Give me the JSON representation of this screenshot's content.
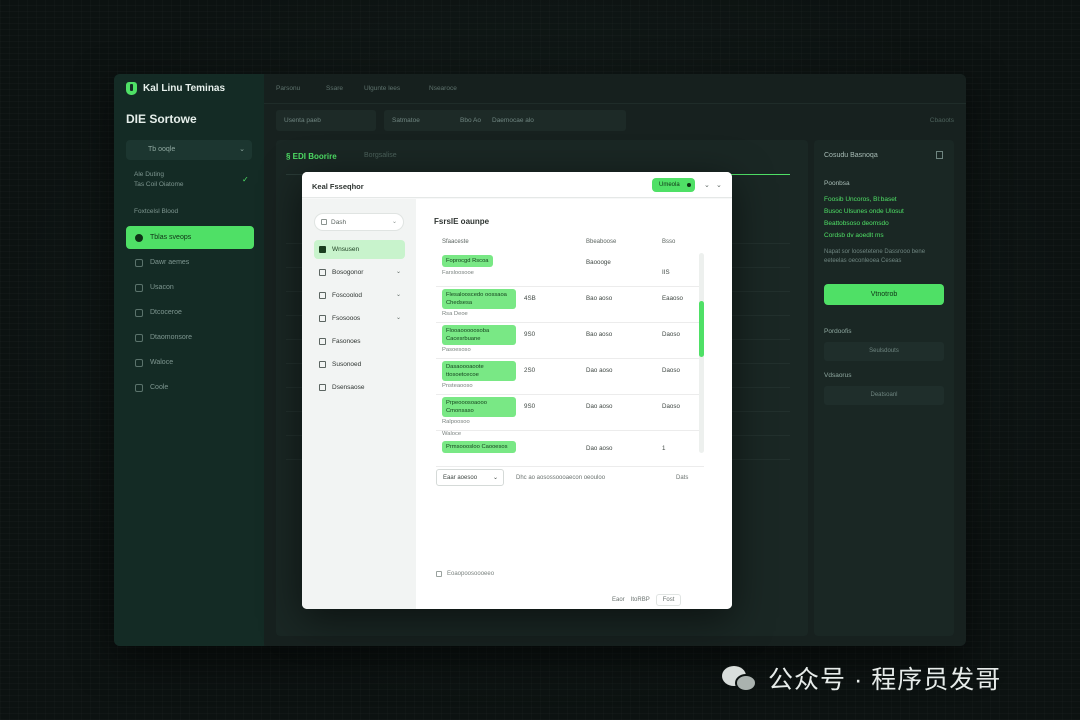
{
  "app": {
    "brand": "Kal Linu Teminas",
    "section_title": "DIE Sortowe",
    "sidebar_select": "Tb ooqle",
    "sidebar_info": [
      "Ale Duting",
      "Tas Coil Oiatome"
    ],
    "sidebar_group": "Foxtcelsl Blood",
    "nav": [
      {
        "label": "Tblas sveops",
        "active": true
      },
      {
        "label": "Dawr aemes",
        "active": false
      },
      {
        "label": "Usacon",
        "active": false
      },
      {
        "label": "Dtcoceroe",
        "active": false
      },
      {
        "label": "Dtaomonsore",
        "active": false
      },
      {
        "label": "Waloce",
        "active": false
      },
      {
        "label": "Coole",
        "active": false
      }
    ],
    "topnav": [
      "Parsonu",
      "Ssare",
      "Ulgunte lees",
      "Nsearoce"
    ],
    "filters": [
      "Usenta paeb",
      "Satmatoe",
      "Bbo Ao",
      "Daemocae alo"
    ],
    "filter_right": "Cbaoots",
    "main_title": "§ EDI Boorire",
    "main_sub": "Borgsalise",
    "right_panel": {
      "header": "Cosudu Basnoqa",
      "label": "Poonbsa",
      "green_lines": [
        "Foosib Uncoros, Bl:baset",
        "Busoc Ulsunes onde Ulosut",
        "Beattobsoso deomsdo",
        "Cordsb dv aoedlt ms"
      ],
      "muted": "Napat sor loosetetene Dassrooo bene eeteelas oeconleoea Ceseas",
      "button": "Vtnotrob",
      "sub1": "Pordoofis",
      "box1": "Seulsdouts",
      "sub2": "Vdsaorus",
      "box2": "Deatsoanl"
    }
  },
  "modal": {
    "title": "Keal Fsseqhor",
    "badge": "Umeola",
    "search": "Dash",
    "nav": [
      {
        "label": "Wnsusen",
        "active": true,
        "chevron": false
      },
      {
        "label": "Bosogonor",
        "active": false,
        "chevron": true
      },
      {
        "label": "Foscoolod",
        "active": false,
        "chevron": true
      },
      {
        "label": "Fsosooos",
        "active": false,
        "chevron": true
      },
      {
        "label": "Fasonoes",
        "active": false,
        "chevron": false
      },
      {
        "label": "Susonoed",
        "active": false,
        "chevron": false
      },
      {
        "label": "Dsensaose",
        "active": false,
        "chevron": false
      }
    ],
    "section_title": "FsrslE oaunpe",
    "columns": [
      "Sfaaceste",
      "Bbeaboose",
      "Bsso"
    ],
    "rows": [
      {
        "pill": "Foprocgd Rscoa",
        "sub": "Farsloosooe",
        "num": "",
        "c2": "Baoooge",
        "c3": "IIS"
      },
      {
        "pill": "Flesalooscedo oossaoa Chedsesa",
        "sub": "Rsa Deoe",
        "num": "4SB",
        "c2": "Bao aoso",
        "c3": "Eaaoso"
      },
      {
        "pill": "Flooaooooosoba Cacesrbuane",
        "sub": "Pasoesoso",
        "num": "9S0",
        "c2": "Bao aoso",
        "c3": "Daoso"
      },
      {
        "pill": "Dasaoooaoote ttosoetcecoe",
        "sub": "Pnsteaooso",
        "num": "2S0",
        "c2": "Dao aoso",
        "c3": "Daoso"
      },
      {
        "pill": "Prpeooosoaooo Cmonsaso",
        "sub": "Ralpoosoo",
        "num": "9S0",
        "c2": "Dao aoso",
        "c3": "Daoso"
      },
      {
        "pill": "Prmsooosloo Caooesos",
        "sub": "Waloce",
        "num": "",
        "c2": "Dao aoso",
        "c3": "1"
      }
    ],
    "footer_select": "Eaar aoesoo",
    "footer_text": "Dhc ao aosossoooaecon oeouloo",
    "footer_right": "Dats",
    "checkbox_label": "Eoaopoosoooeeo",
    "pager": [
      "Eaor",
      "ItoRBP",
      "Fost"
    ]
  },
  "watermark": "公众号 · 程序员发哥"
}
